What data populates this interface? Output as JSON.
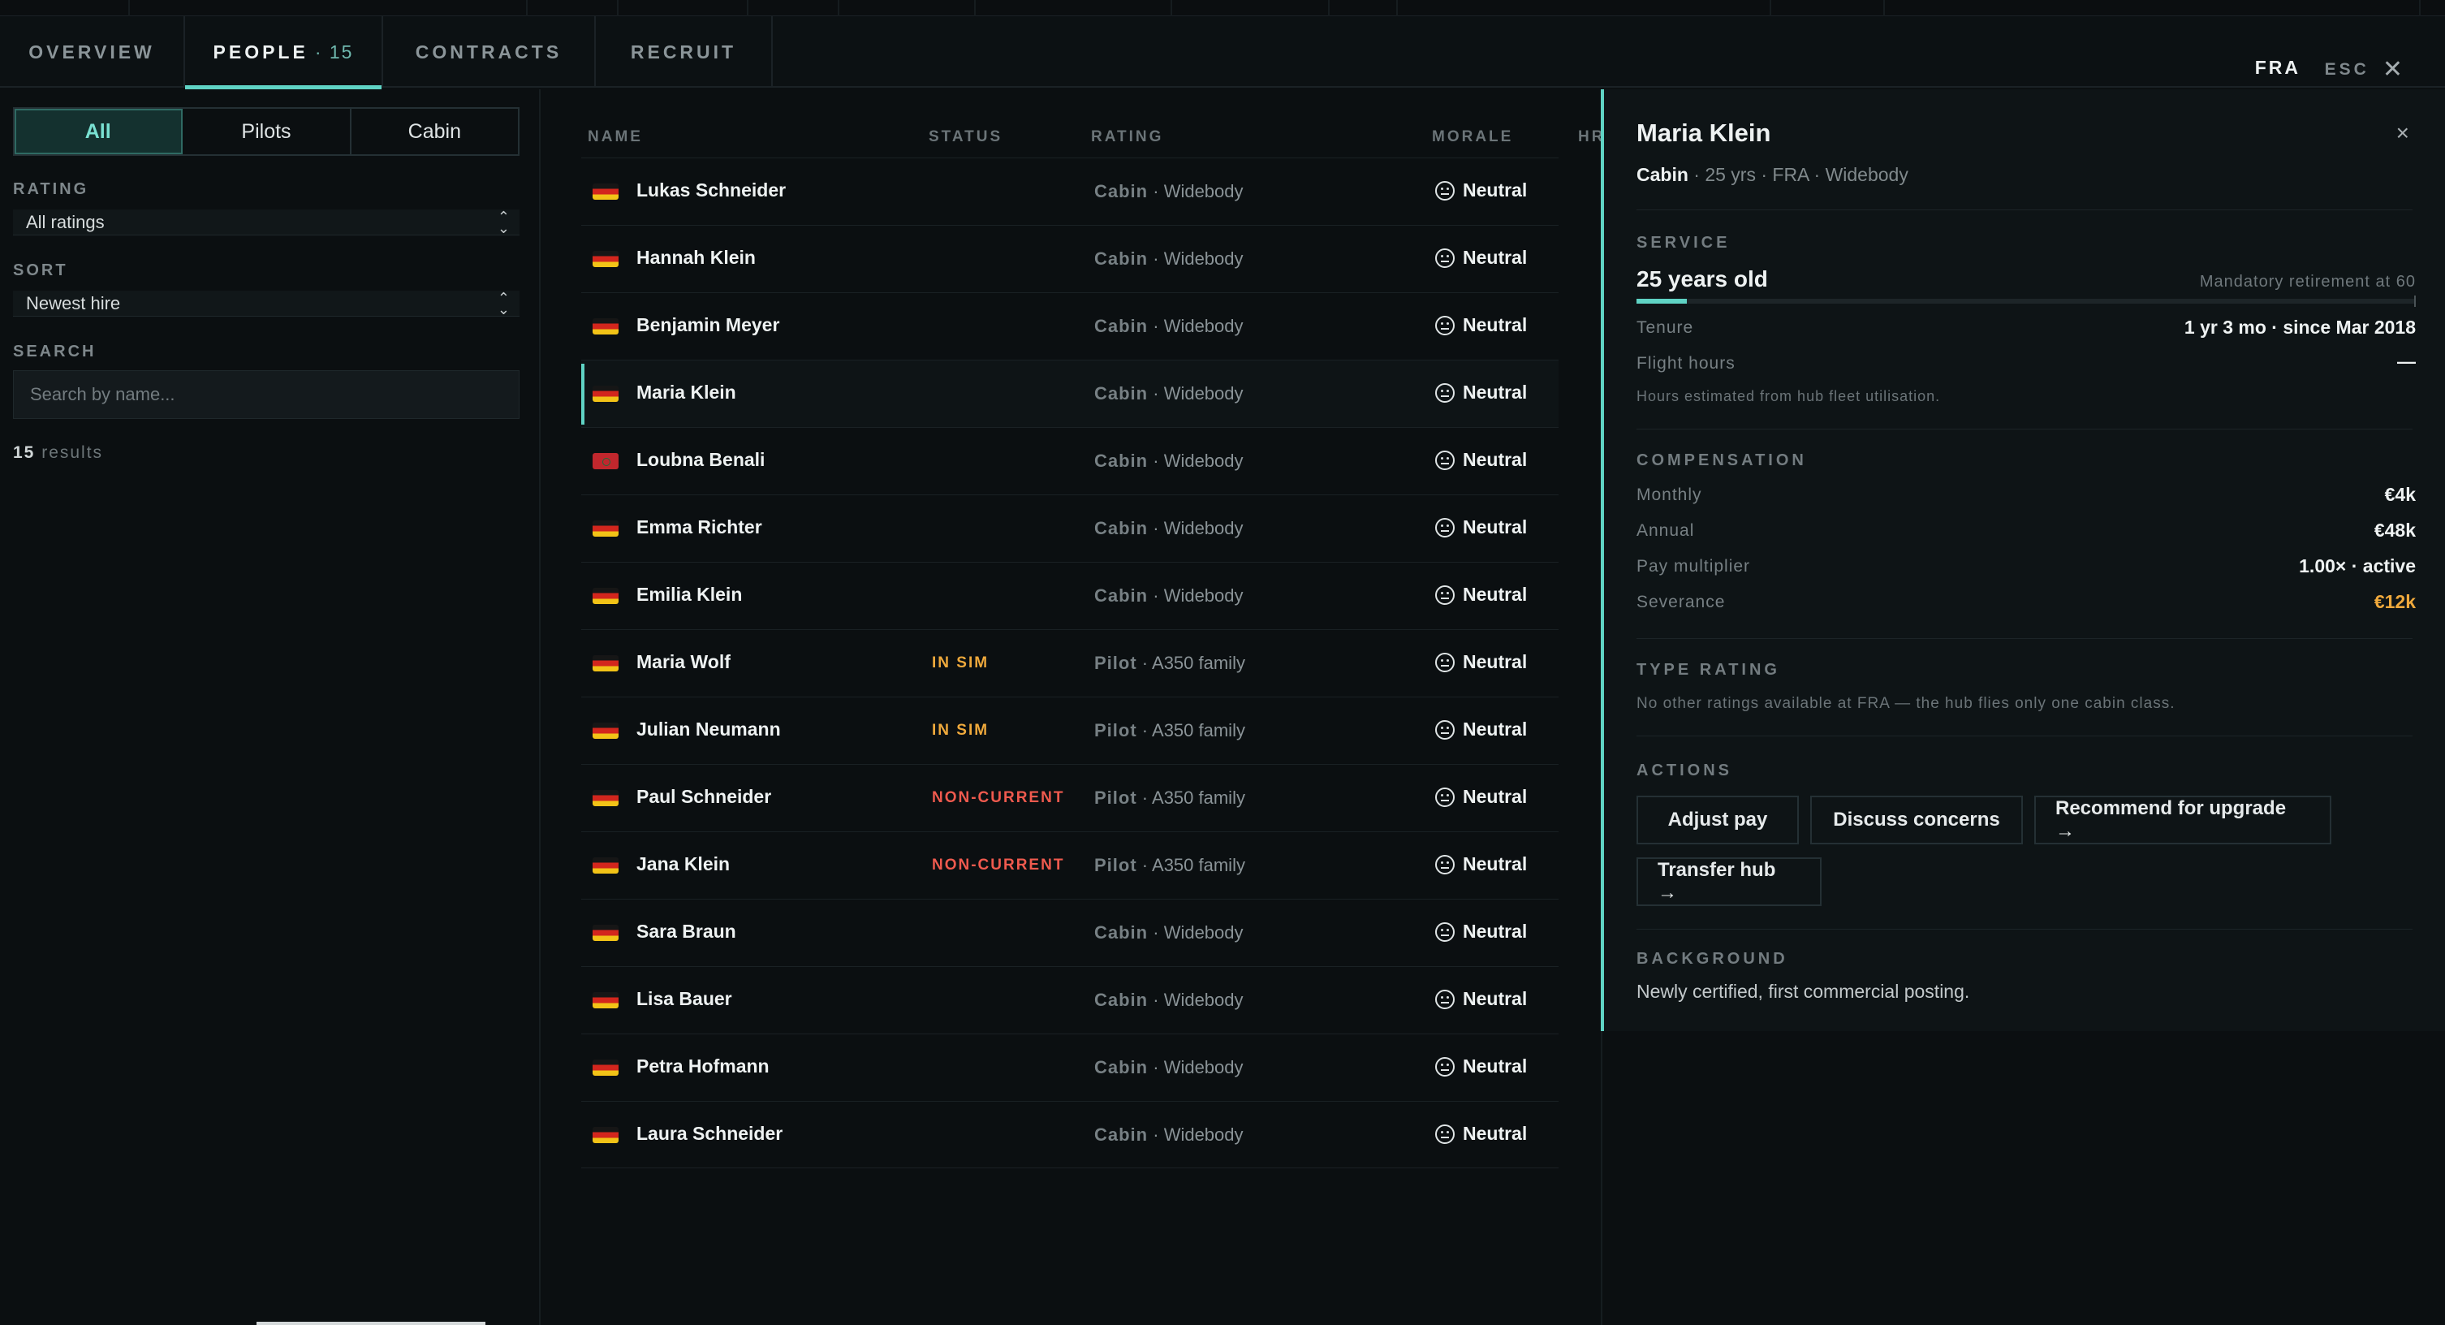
{
  "tabs": {
    "overview": "OVERVIEW",
    "people": "PEOPLE",
    "people_count": "· 15",
    "contracts": "CONTRACTS",
    "recruit": "RECRUIT"
  },
  "header": {
    "hub_code": "FRA",
    "esc_label": "ESC",
    "close_glyph": "✕"
  },
  "filters": {
    "segments": [
      "All",
      "Pilots",
      "Cabin"
    ],
    "active_segment": "All",
    "rating_label": "RATING",
    "rating_value": "All ratings",
    "sort_label": "SORT",
    "sort_value": "Newest hire",
    "search_label": "SEARCH",
    "search_placeholder": "Search by name...",
    "results_count": "15",
    "results_label": "results"
  },
  "table": {
    "columns": [
      "NAME",
      "STATUS",
      "RATING",
      "MORALE",
      "HR"
    ],
    "rows": [
      {
        "flag": "de",
        "name": "Lukas Schneider",
        "status": "",
        "role": "Cabin",
        "rating": "Widebody",
        "morale": "Neutral"
      },
      {
        "flag": "de",
        "name": "Hannah Klein",
        "status": "",
        "role": "Cabin",
        "rating": "Widebody",
        "morale": "Neutral"
      },
      {
        "flag": "de",
        "name": "Benjamin Meyer",
        "status": "",
        "role": "Cabin",
        "rating": "Widebody",
        "morale": "Neutral"
      },
      {
        "flag": "de",
        "name": "Maria Klein",
        "status": "",
        "role": "Cabin",
        "rating": "Widebody",
        "morale": "Neutral",
        "selected": true
      },
      {
        "flag": "ma",
        "name": "Loubna Benali",
        "status": "",
        "role": "Cabin",
        "rating": "Widebody",
        "morale": "Neutral"
      },
      {
        "flag": "de",
        "name": "Emma Richter",
        "status": "",
        "role": "Cabin",
        "rating": "Widebody",
        "morale": "Neutral"
      },
      {
        "flag": "de",
        "name": "Emilia Klein",
        "status": "",
        "role": "Cabin",
        "rating": "Widebody",
        "morale": "Neutral"
      },
      {
        "flag": "de",
        "name": "Maria Wolf",
        "status": "IN SIM",
        "role": "Pilot",
        "rating": "A350 family",
        "morale": "Neutral"
      },
      {
        "flag": "de",
        "name": "Julian Neumann",
        "status": "IN SIM",
        "role": "Pilot",
        "rating": "A350 family",
        "morale": "Neutral"
      },
      {
        "flag": "de",
        "name": "Paul Schneider",
        "status": "NON-CURRENT",
        "role": "Pilot",
        "rating": "A350 family",
        "morale": "Neutral"
      },
      {
        "flag": "de",
        "name": "Jana Klein",
        "status": "NON-CURRENT",
        "role": "Pilot",
        "rating": "A350 family",
        "morale": "Neutral"
      },
      {
        "flag": "de",
        "name": "Sara Braun",
        "status": "",
        "role": "Cabin",
        "rating": "Widebody",
        "morale": "Neutral"
      },
      {
        "flag": "de",
        "name": "Lisa Bauer",
        "status": "",
        "role": "Cabin",
        "rating": "Widebody",
        "morale": "Neutral"
      },
      {
        "flag": "de",
        "name": "Petra Hofmann",
        "status": "",
        "role": "Cabin",
        "rating": "Widebody",
        "morale": "Neutral"
      },
      {
        "flag": "de",
        "name": "Laura Schneider",
        "status": "",
        "role": "Cabin",
        "rating": "Widebody",
        "morale": "Neutral"
      }
    ]
  },
  "detail": {
    "name": "Maria Klein",
    "close_glyph": "×",
    "role": "Cabin",
    "subtitle_rest": "· 25 yrs · FRA · Widebody",
    "service_label": "SERVICE",
    "age_text": "25 years old",
    "retirement_note": "Mandatory retirement at 60",
    "service_progress": 0.065,
    "tenure_label": "Tenure",
    "tenure_value": "1 yr 3 mo · since Mar 2018",
    "flight_hours_label": "Flight hours",
    "flight_hours_value": "—",
    "hours_note": "Hours estimated from hub fleet utilisation.",
    "compensation_label": "COMPENSATION",
    "monthly_label": "Monthly",
    "monthly_value": "€4k",
    "annual_label": "Annual",
    "annual_value": "€48k",
    "multiplier_label": "Pay multiplier",
    "multiplier_value": "1.00× · active",
    "severance_label": "Severance",
    "severance_value": "€12k",
    "type_rating_label": "TYPE RATING",
    "type_rating_note": "No other ratings available at FRA — the hub flies only one cabin class.",
    "actions_label": "ACTIONS",
    "actions": [
      "Adjust pay",
      "Discuss concerns",
      "Recommend for upgrade →",
      "Transfer hub →"
    ],
    "background_label": "BACKGROUND",
    "background_text": "Newly certified, first commercial posting."
  },
  "colors": {
    "accent": "#5fd3c4",
    "warning": "#efa93c",
    "danger": "#ef5a4e",
    "background": "#0b0f11"
  }
}
